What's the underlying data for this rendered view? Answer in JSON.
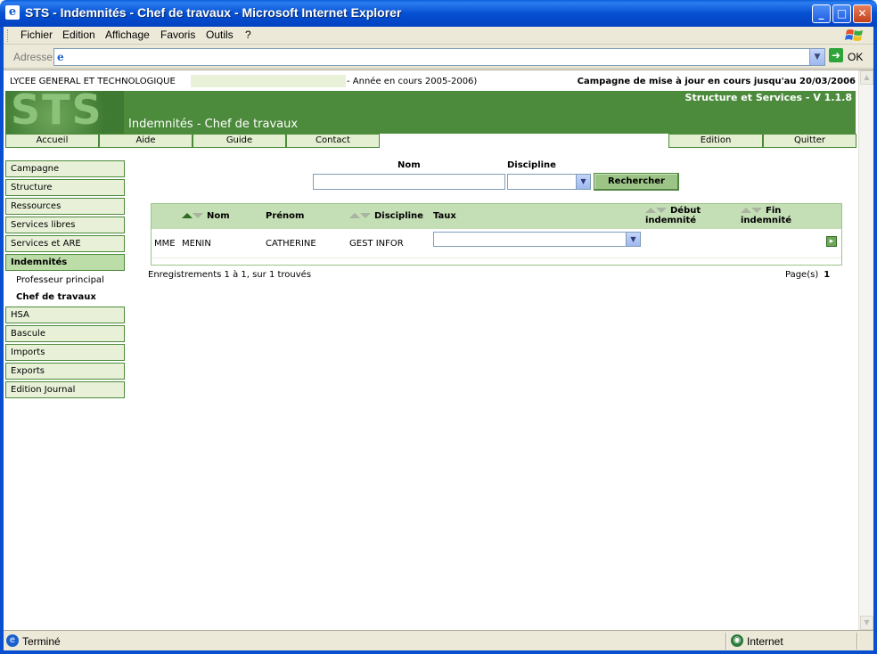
{
  "window": {
    "title": "STS - Indemnités - Chef de travaux - Microsoft Internet Explorer",
    "buttons": {
      "minimize": "_",
      "maximize": "□",
      "close": "✕"
    }
  },
  "menubar": {
    "items": [
      "Fichier",
      "Edition",
      "Affichage",
      "Favoris",
      "Outils",
      "?"
    ]
  },
  "addressbar": {
    "label": "Adresse",
    "url": "",
    "go_label": "OK"
  },
  "page": {
    "lycee": "LYCEE GENERAL ET TECHNOLOGIQUE",
    "annee": "- Année en cours 2005-2006)",
    "campagne": "Campagne de mise à jour en cours jusqu'au 20/03/2006",
    "logo_text": "STS",
    "version": "Structure et Services - V 1.1.8",
    "page_title": "Indemnités - Chef de travaux",
    "topnav_left": [
      "Accueil",
      "Aide",
      "Guide",
      "Contact"
    ],
    "topnav_right": [
      "Edition",
      "Quitter"
    ]
  },
  "leftnav": {
    "sections": [
      "Campagne",
      "Structure",
      "Ressources",
      "Services libres",
      "Services et ARE",
      "Indemnités",
      "HSA",
      "Bascule",
      "Imports",
      "Exports",
      "Edition Journal"
    ],
    "active": "Indemnités",
    "sub_items": [
      "Professeur principal",
      "Chef de travaux"
    ],
    "current_sub": "Chef de travaux"
  },
  "search": {
    "nom_label": "Nom",
    "nom_value": "",
    "discipline_label": "Discipline",
    "discipline_value": "",
    "button": "Rechercher"
  },
  "table": {
    "headers": {
      "nom": "Nom",
      "prenom": "Prénom",
      "discipline": "Discipline",
      "taux": "Taux",
      "debut": [
        "Début",
        "indemnité"
      ],
      "fin": [
        "Fin",
        "indemnité"
      ]
    },
    "rows": [
      {
        "civilite": "MME",
        "nom": "MENIN",
        "prenom": "CATHERINE",
        "discipline": "GEST INFOR",
        "taux": "",
        "debut": "",
        "fin": ""
      }
    ]
  },
  "pagination": {
    "records": "Enregistrements 1 à 1, sur 1 trouvés",
    "pages_label": "Page(s)",
    "current_page": "1"
  },
  "statusbar": {
    "status": "Terminé",
    "zone": "Internet"
  },
  "colors": {
    "green_dark": "#4c8a3c",
    "green_light": "#e8f1d8",
    "green_header": "#c4deb5",
    "xp_blue": "#0a4fd0"
  }
}
